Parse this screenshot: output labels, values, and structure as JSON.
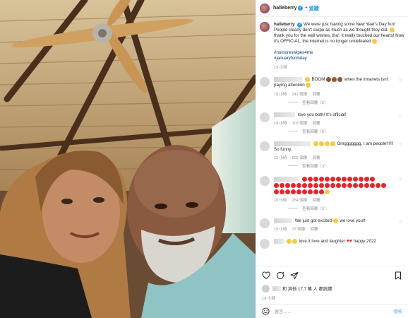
{
  "post": {
    "username": "halleberry",
    "follow_label": "追蹤",
    "caption": "We were just having some New Year's Day fun! People clearly don't swipe as much as we thought they did.",
    "caption_2": "thank you for the well wishes, tho', it really touched our hearts! Now it's OFFICIAL, the internet is no longer undefeated",
    "tag_1": "#nomoreswipes4me",
    "tag_2": "#januaryfoolsday",
    "age": "19 小時"
  },
  "comments": [
    {
      "text_prefix": "BOOM",
      "text": "when the innanets isn't paying attention",
      "time": "19 小時",
      "likes": "247 個讚",
      "reply": "回覆",
      "view_replies": "查看回覆（2）"
    },
    {
      "text": "love you both! It's official!",
      "time": "19 小時",
      "likes": "103 個讚",
      "reply": "回覆",
      "view_replies": "查看回覆（6）"
    },
    {
      "text": "Omggggggg. I am people!!!!!!",
      "text_2": "So funny.",
      "time": "19 小時",
      "likes": "502 個讚",
      "reply": "回覆",
      "view_replies": "查看回覆（3）"
    },
    {
      "time": "18 小時",
      "likes": "254 個讚",
      "reply": "回覆",
      "view_replies": "查看回覆（5）"
    },
    {
      "text": "We just got excited",
      "text_2": "we love you!!",
      "time": "19 小時",
      "likes": "33 個讚",
      "reply": "回覆"
    },
    {
      "text": "love it love and laughter",
      "text_2": "happy 2022"
    }
  ],
  "actions": {
    "likes_text": "和 其他 17.7 萬 人 都說讚",
    "date": "19 小時"
  },
  "add_comment": {
    "placeholder": "留言……",
    "post_label": "發佈"
  },
  "icons": [
    "heart-icon",
    "comment-icon",
    "share-icon",
    "bookmark-icon",
    "emoji-icon",
    "more-icon"
  ],
  "colors": {
    "link": "#00376b",
    "accent": "#0095f6",
    "heart": "#e0282e"
  }
}
